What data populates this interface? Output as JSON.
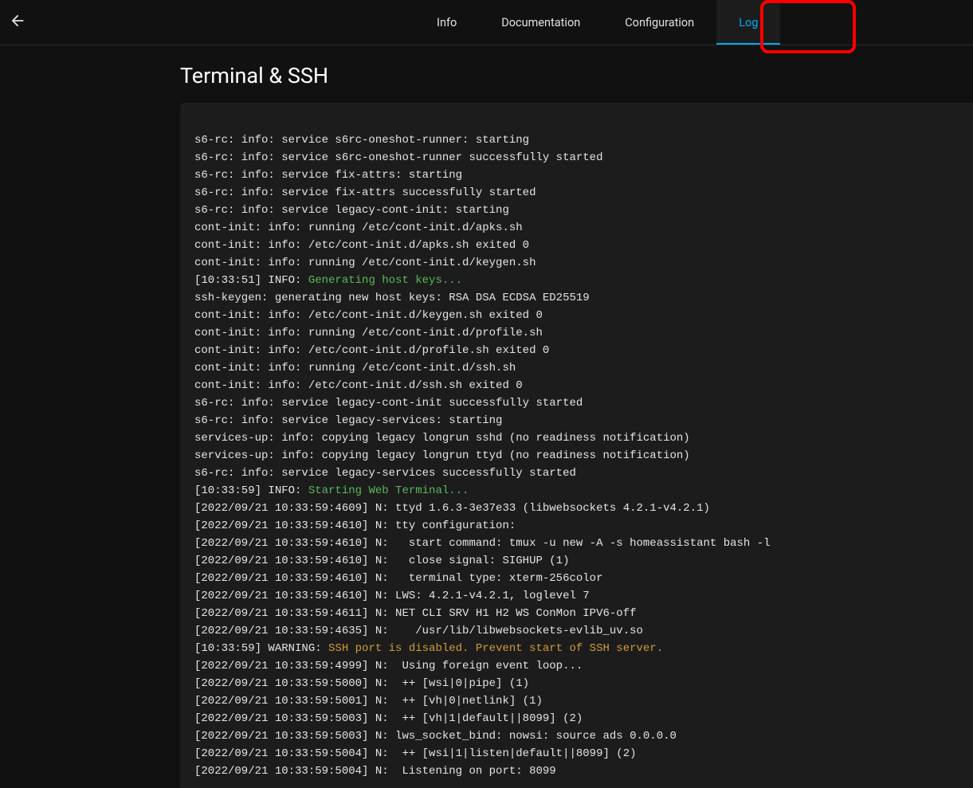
{
  "header": {
    "tabs": [
      {
        "label": "Info",
        "active": false
      },
      {
        "label": "Documentation",
        "active": false
      },
      {
        "label": "Configuration",
        "active": false
      },
      {
        "label": "Log",
        "active": true
      }
    ]
  },
  "page": {
    "title": "Terminal & SSH"
  },
  "log": {
    "lines": [
      {
        "segments": [
          {
            "text": "s6-rc: info: service s6rc-oneshot-runner: starting"
          }
        ]
      },
      {
        "segments": [
          {
            "text": "s6-rc: info: service s6rc-oneshot-runner successfully started"
          }
        ]
      },
      {
        "segments": [
          {
            "text": "s6-rc: info: service fix-attrs: starting"
          }
        ]
      },
      {
        "segments": [
          {
            "text": "s6-rc: info: service fix-attrs successfully started"
          }
        ]
      },
      {
        "segments": [
          {
            "text": "s6-rc: info: service legacy-cont-init: starting"
          }
        ]
      },
      {
        "segments": [
          {
            "text": "cont-init: info: running /etc/cont-init.d/apks.sh"
          }
        ]
      },
      {
        "segments": [
          {
            "text": "cont-init: info: /etc/cont-init.d/apks.sh exited 0"
          }
        ]
      },
      {
        "segments": [
          {
            "text": "cont-init: info: running /etc/cont-init.d/keygen.sh"
          }
        ]
      },
      {
        "segments": [
          {
            "text": "[10:33:51] INFO: "
          },
          {
            "text": "Generating host keys...",
            "cls": "log-green"
          }
        ]
      },
      {
        "segments": [
          {
            "text": "ssh-keygen: generating new host keys: RSA DSA ECDSA ED25519"
          }
        ]
      },
      {
        "segments": [
          {
            "text": "cont-init: info: /etc/cont-init.d/keygen.sh exited 0"
          }
        ]
      },
      {
        "segments": [
          {
            "text": "cont-init: info: running /etc/cont-init.d/profile.sh"
          }
        ]
      },
      {
        "segments": [
          {
            "text": "cont-init: info: /etc/cont-init.d/profile.sh exited 0"
          }
        ]
      },
      {
        "segments": [
          {
            "text": "cont-init: info: running /etc/cont-init.d/ssh.sh"
          }
        ]
      },
      {
        "segments": [
          {
            "text": "cont-init: info: /etc/cont-init.d/ssh.sh exited 0"
          }
        ]
      },
      {
        "segments": [
          {
            "text": "s6-rc: info: service legacy-cont-init successfully started"
          }
        ]
      },
      {
        "segments": [
          {
            "text": "s6-rc: info: service legacy-services: starting"
          }
        ]
      },
      {
        "segments": [
          {
            "text": "services-up: info: copying legacy longrun sshd (no readiness notification)"
          }
        ]
      },
      {
        "segments": [
          {
            "text": "services-up: info: copying legacy longrun ttyd (no readiness notification)"
          }
        ]
      },
      {
        "segments": [
          {
            "text": "s6-rc: info: service legacy-services successfully started"
          }
        ]
      },
      {
        "segments": [
          {
            "text": "[10:33:59] INFO: "
          },
          {
            "text": "Starting Web Terminal...",
            "cls": "log-green"
          }
        ]
      },
      {
        "segments": [
          {
            "text": "[2022/09/21 10:33:59:4609] N: ttyd 1.6.3-3e37e33 (libwebsockets 4.2.1-v4.2.1)"
          }
        ]
      },
      {
        "segments": [
          {
            "text": "[2022/09/21 10:33:59:4610] N: tty configuration:"
          }
        ]
      },
      {
        "segments": [
          {
            "text": "[2022/09/21 10:33:59:4610] N:   start command: tmux -u new -A -s homeassistant bash -l"
          }
        ]
      },
      {
        "segments": [
          {
            "text": "[2022/09/21 10:33:59:4610] N:   close signal: SIGHUP (1)"
          }
        ]
      },
      {
        "segments": [
          {
            "text": "[2022/09/21 10:33:59:4610] N:   terminal type: xterm-256color"
          }
        ]
      },
      {
        "segments": [
          {
            "text": "[2022/09/21 10:33:59:4610] N: LWS: 4.2.1-v4.2.1, loglevel 7"
          }
        ]
      },
      {
        "segments": [
          {
            "text": "[2022/09/21 10:33:59:4611] N: NET CLI SRV H1 H2 WS ConMon IPV6-off"
          }
        ]
      },
      {
        "segments": [
          {
            "text": "[2022/09/21 10:33:59:4635] N:    /usr/lib/libwebsockets-evlib_uv.so"
          }
        ]
      },
      {
        "segments": [
          {
            "text": "[10:33:59] WARNING: "
          },
          {
            "text": "SSH port is disabled. Prevent start of SSH server.",
            "cls": "log-orange"
          }
        ]
      },
      {
        "segments": [
          {
            "text": "[2022/09/21 10:33:59:4999] N:  Using foreign event loop..."
          }
        ]
      },
      {
        "segments": [
          {
            "text": "[2022/09/21 10:33:59:5000] N:  ++ [wsi|0|pipe] (1)"
          }
        ]
      },
      {
        "segments": [
          {
            "text": "[2022/09/21 10:33:59:5001] N:  ++ [vh|0|netlink] (1)"
          }
        ]
      },
      {
        "segments": [
          {
            "text": "[2022/09/21 10:33:59:5003] N:  ++ [vh|1|default||8099] (2)"
          }
        ]
      },
      {
        "segments": [
          {
            "text": "[2022/09/21 10:33:59:5003] N: lws_socket_bind: nowsi: source ads 0.0.0.0"
          }
        ]
      },
      {
        "segments": [
          {
            "text": "[2022/09/21 10:33:59:5004] N:  ++ [wsi|1|listen|default||8099] (2)"
          }
        ]
      },
      {
        "segments": [
          {
            "text": "[2022/09/21 10:33:59:5004] N:  Listening on port: 8099"
          }
        ]
      }
    ]
  }
}
